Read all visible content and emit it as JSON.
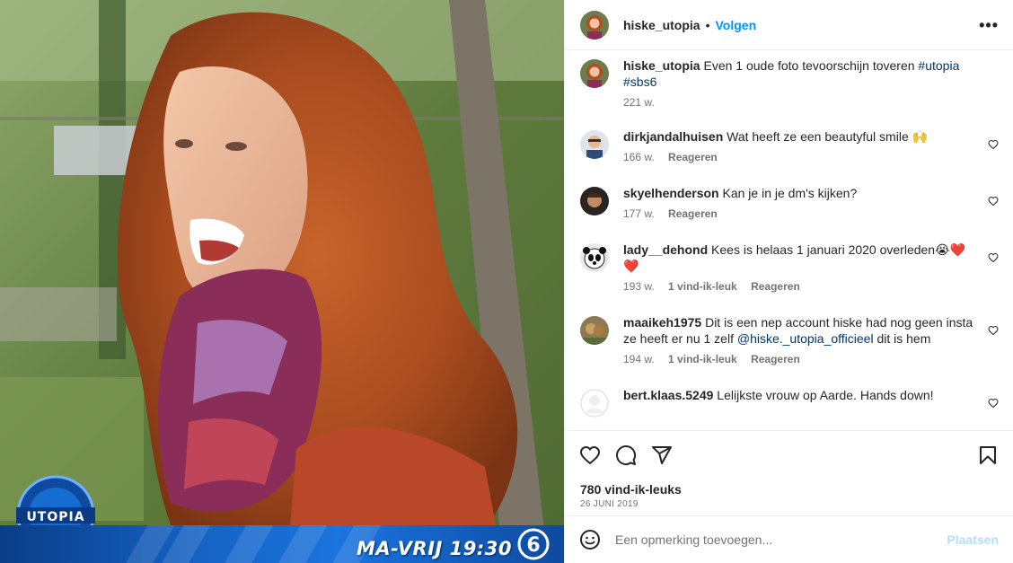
{
  "header": {
    "username": "hiske_utopia",
    "dot": "•",
    "follow_label": "Volgen",
    "more": "•••"
  },
  "caption": {
    "user": "hiske_utopia",
    "text": "Even 1 oude foto tevoorschijn toveren",
    "tags": [
      "#utopia",
      "#sbs6"
    ],
    "age": "221 w."
  },
  "comments": [
    {
      "user": "dirkjandalhuisen",
      "text": "Wat heeft ze een beautyful smile 🙌",
      "age": "166 w.",
      "likes": "",
      "reply": "Reageren"
    },
    {
      "user": "skyelhenderson",
      "text": "Kan je in je dm's kijken?",
      "age": "177 w.",
      "likes": "",
      "reply": "Reageren"
    },
    {
      "user": "lady__dehond",
      "text": "Kees is helaas 1 januari 2020 overleden😭❤️❤️",
      "age": "193 w.",
      "likes": "1 vind-ik-leuk",
      "reply": "Reageren"
    },
    {
      "user": "maaikeh1975",
      "text": "Dit is een nep account hiske had nog geen insta ze heeft er nu 1 zelf",
      "mention": "@hiske._utopia_officieel",
      "text_after": "dit is hem",
      "age": "194 w.",
      "likes": "1 vind-ik-leuk",
      "reply": "Reageren"
    },
    {
      "user": "bert.klaas.5249",
      "text": "Lelijkste vrouw op Aarde. Hands down!",
      "age": "",
      "likes": "",
      "reply": ""
    }
  ],
  "stats": {
    "likes": "780 vind-ik-leuks",
    "date": "26 JUNI 2019"
  },
  "composer": {
    "placeholder": "Een opmerking toevoegen...",
    "post_label": "Plaatsen"
  },
  "media": {
    "show_time": "MA-VRIJ 19:30",
    "show_logo_text": "UTOPIA",
    "channel": "6"
  },
  "colors": {
    "accent": "#0095f6",
    "hashtag": "#00376b",
    "muted": "#737373",
    "banner": "#1562c4"
  },
  "icons": {
    "like": "heart-icon",
    "comment": "comment-bubble-icon",
    "share": "paper-plane-icon",
    "save": "bookmark-icon",
    "emoji": "smiley-icon",
    "more": "more-options-icon"
  }
}
